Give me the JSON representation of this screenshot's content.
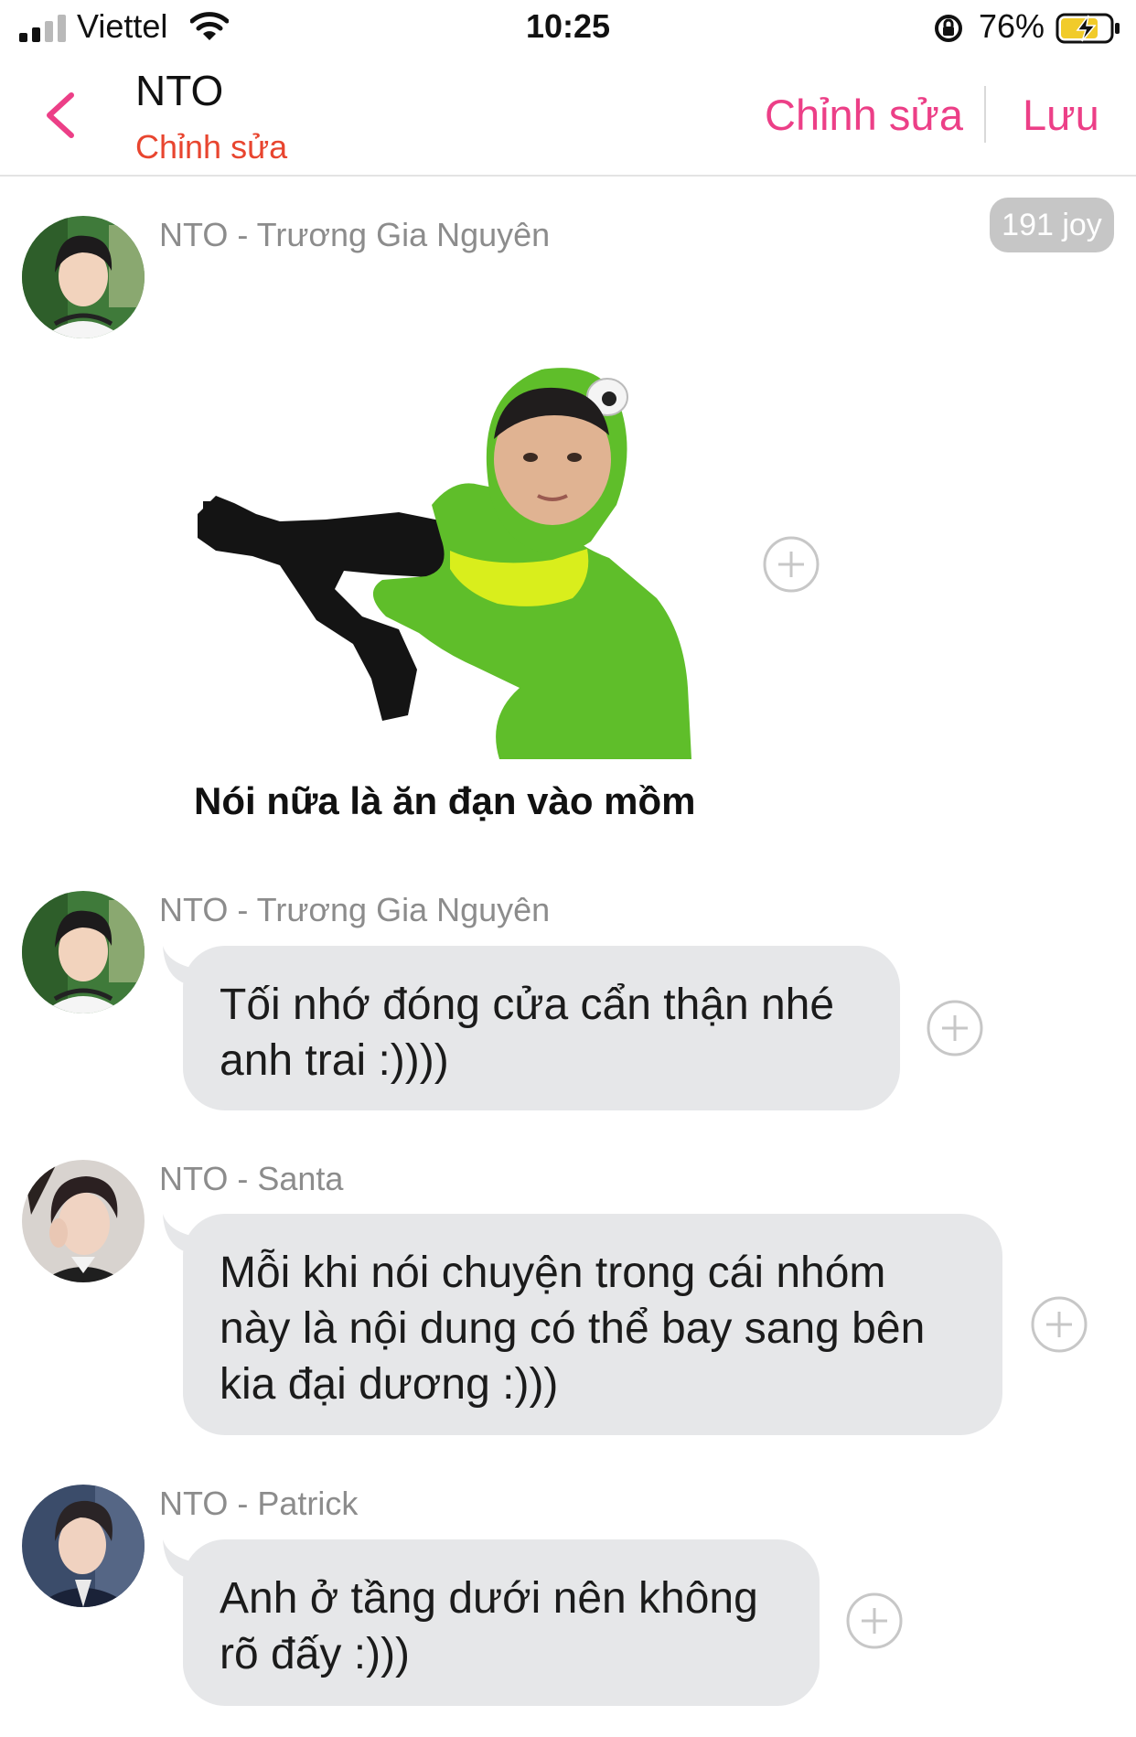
{
  "status_bar": {
    "carrier": "Viettel",
    "time": "10:25",
    "battery_percent": "76%",
    "icons": [
      "signal-icon",
      "wifi-icon",
      "rotation-lock-icon",
      "battery-charging-icon"
    ]
  },
  "nav": {
    "title": "NTO",
    "subtitle": "Chỉnh sửa",
    "edit_label": "Chỉnh sửa",
    "save_label": "Lưu",
    "accent_color": "#ec3f87",
    "subtitle_color": "#e8452f"
  },
  "messages": [
    {
      "sender": "NTO - Trương Gia Nguyên",
      "type": "sticker",
      "joy_badge": "191 joy",
      "sticker_caption": "Nói nữa là ăn đạn vào mồm"
    },
    {
      "sender": "NTO - Trương Gia Nguyên",
      "type": "text",
      "text": "Tối nhớ đóng cửa cẩn thận nhé anh trai :))))"
    },
    {
      "sender": "NTO - Santa",
      "type": "text",
      "text": "Mỗi khi nói chuyện trong cái nhóm này là nội dung có thể bay sang bên kia đại dương :)))"
    },
    {
      "sender": "NTO - Patrick",
      "type": "text",
      "text": "Anh ở tầng dưới nên không rõ đấy :)))"
    }
  ]
}
